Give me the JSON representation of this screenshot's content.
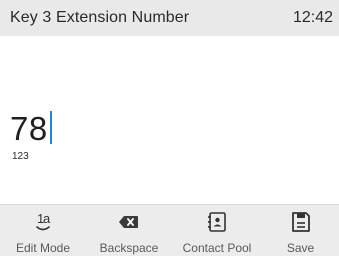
{
  "header": {
    "title": "Key 3 Extension Number",
    "time": "12:42"
  },
  "input": {
    "value": "78",
    "mode": "123"
  },
  "softkeys": [
    {
      "label": "Edit Mode",
      "icon": "edit-mode-icon"
    },
    {
      "label": "Backspace",
      "icon": "backspace-icon"
    },
    {
      "label": "Contact Pool",
      "icon": "contact-pool-icon"
    },
    {
      "label": "Save",
      "icon": "save-icon"
    }
  ],
  "colors": {
    "header_bg": "#e9e9e9",
    "softkey_bg": "#ececec",
    "cursor": "#2f7de1"
  }
}
